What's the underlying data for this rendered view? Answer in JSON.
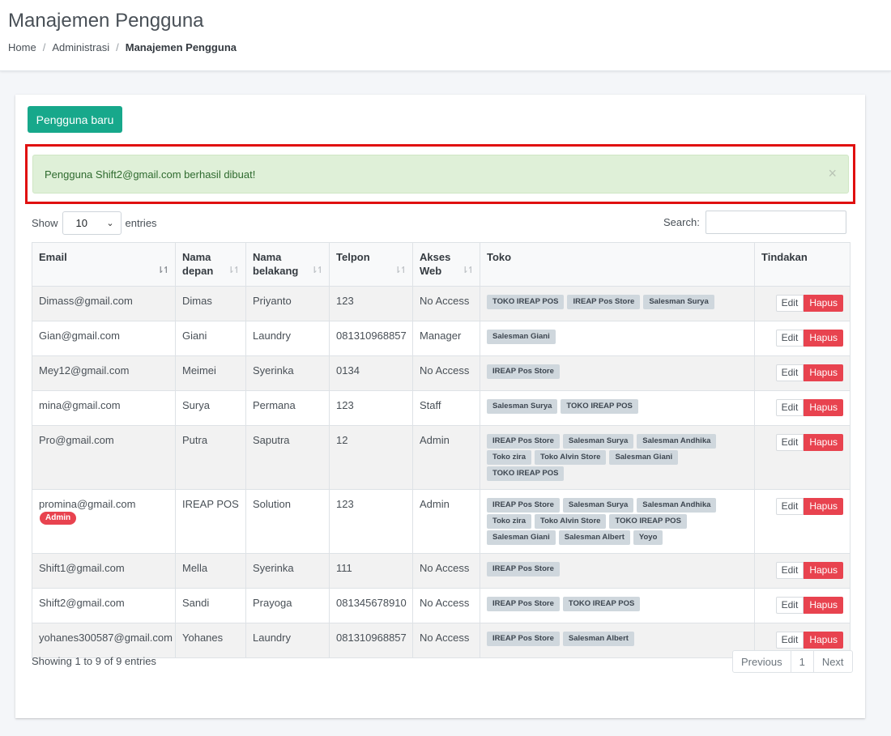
{
  "header": {
    "title": "Manajemen Pengguna",
    "breadcrumb": [
      "Home",
      "Administrasi",
      "Manajemen Pengguna"
    ]
  },
  "toolbar": {
    "new_user_label": "Pengguna baru"
  },
  "alert": {
    "message": "Pengguna Shift2@gmail.com berhasil dibuat!",
    "close_icon": "×"
  },
  "table_controls": {
    "show_label": "Show",
    "length_value": "10",
    "entries_label": "entries",
    "search_label": "Search:",
    "search_value": ""
  },
  "table": {
    "columns": [
      {
        "label1": "Email",
        "label2": ""
      },
      {
        "label1": "Nama",
        "label2": "depan"
      },
      {
        "label1": "Nama",
        "label2": "belakang"
      },
      {
        "label1": "Telpon",
        "label2": ""
      },
      {
        "label1": "Akses",
        "label2": "Web"
      },
      {
        "label1": "Toko",
        "label2": ""
      },
      {
        "label1": "Tindakan",
        "label2": ""
      }
    ],
    "edit_label": "Edit",
    "delete_label": "Hapus",
    "rows": [
      {
        "email": "Dimass@gmail.com",
        "badge": "",
        "first": "Dimas",
        "last": "Priyanto",
        "phone": "123",
        "access": "No Access",
        "stores": [
          "TOKO IREAP POS",
          "IREAP Pos Store",
          "Salesman Surya"
        ]
      },
      {
        "email": "Gian@gmail.com",
        "badge": "",
        "first": "Giani",
        "last": "Laundry",
        "phone": "081310968857",
        "access": "Manager",
        "stores": [
          "Salesman Giani"
        ]
      },
      {
        "email": "Mey12@gmail.com",
        "badge": "",
        "first": "Meimei",
        "last": "Syerinka",
        "phone": "0134",
        "access": "No Access",
        "stores": [
          "IREAP Pos Store"
        ]
      },
      {
        "email": "mina@gmail.com",
        "badge": "",
        "first": "Surya",
        "last": "Permana",
        "phone": "123",
        "access": "Staff",
        "stores": [
          "Salesman Surya",
          "TOKO IREAP POS"
        ]
      },
      {
        "email": "Pro@gmail.com",
        "badge": "",
        "first": "Putra",
        "last": "Saputra",
        "phone": "12",
        "access": "Admin",
        "stores": [
          "IREAP Pos Store",
          "Salesman Surya",
          "Salesman Andhika",
          "Toko zira",
          "Toko Alvin Store",
          "Salesman Giani",
          "TOKO IREAP POS"
        ]
      },
      {
        "email": "promina@gmail.com",
        "badge": "Admin",
        "first": "IREAP POS",
        "last": "Solution",
        "phone": "123",
        "access": "Admin",
        "stores": [
          "IREAP Pos Store",
          "Salesman Surya",
          "Salesman Andhika",
          "Toko zira",
          "Toko Alvin Store",
          "TOKO IREAP POS",
          "Salesman Giani",
          "Salesman Albert",
          "Yoyo"
        ]
      },
      {
        "email": "Shift1@gmail.com",
        "badge": "",
        "first": "Mella",
        "last": "Syerinka",
        "phone": "111",
        "access": "No Access",
        "stores": [
          "IREAP Pos Store"
        ]
      },
      {
        "email": "Shift2@gmail.com",
        "badge": "",
        "first": "Sandi",
        "last": "Prayoga",
        "phone": "081345678910",
        "access": "No Access",
        "stores": [
          "IREAP Pos Store",
          "TOKO IREAP POS"
        ]
      },
      {
        "email": "yohanes300587@gmail.com",
        "badge": "",
        "first": "Yohanes",
        "last": "Laundry",
        "phone": "081310968857",
        "access": "No Access",
        "stores": [
          "IREAP Pos Store",
          "Salesman Albert"
        ]
      }
    ]
  },
  "footer": {
    "info": "Showing 1 to 9 of 9 entries",
    "prev_label": "Previous",
    "page_label": "1",
    "next_label": "Next"
  },
  "colors": {
    "primary_button": "#17a88b",
    "danger": "#e8434f",
    "alert_bg": "#dff0d8",
    "highlight": "#e01010"
  },
  "icons": {
    "sort": "sort-arrows-icon",
    "close": "close-icon",
    "dropdown": "chevron-down-icon"
  }
}
